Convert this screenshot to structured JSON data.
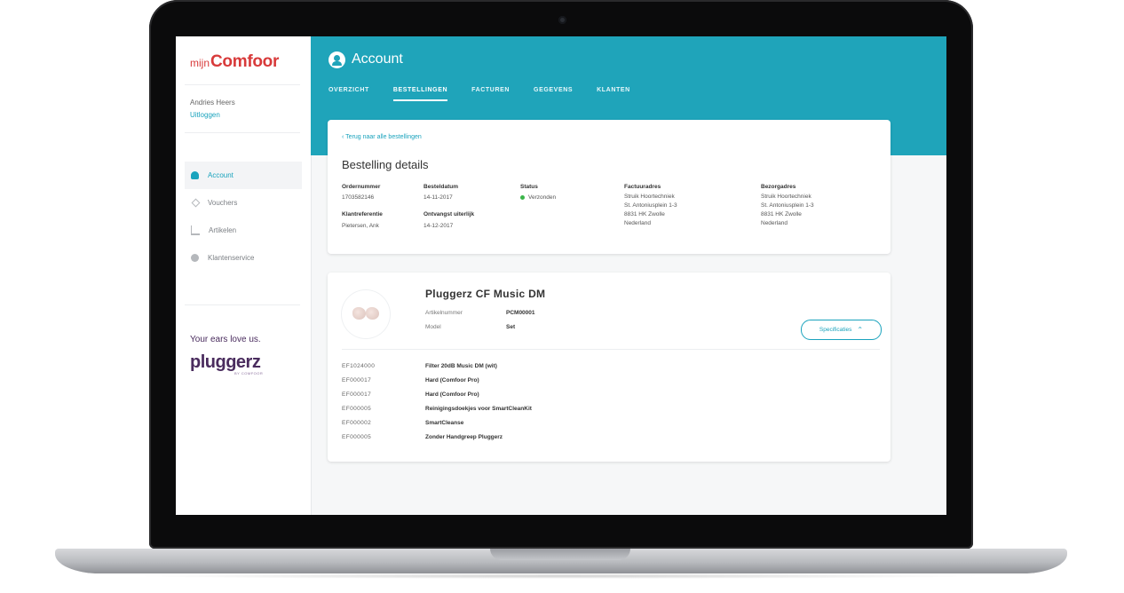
{
  "sidebar": {
    "logo_prefix": "mijn",
    "logo_main": "Comfoor",
    "user_name": "Andries Heers",
    "logout": "Uitloggen",
    "nav": [
      {
        "label": "Account",
        "icon": "user-icon",
        "active": true
      },
      {
        "label": "Vouchers",
        "icon": "tag-icon",
        "active": false
      },
      {
        "label": "Artikelen",
        "icon": "cart-icon",
        "active": false
      },
      {
        "label": "Klantenservice",
        "icon": "help-icon",
        "active": false
      }
    ],
    "tagline": "Your ears love us.",
    "brand": "pluggerz",
    "brand_sub": "BY COMFOOR"
  },
  "header": {
    "title": "Account",
    "tabs": [
      {
        "label": "OVERZICHT",
        "active": false
      },
      {
        "label": "BESTELLINGEN",
        "active": true
      },
      {
        "label": "FACTUREN",
        "active": false
      },
      {
        "label": "GEGEVENS",
        "active": false
      },
      {
        "label": "KLANTEN",
        "active": false
      }
    ]
  },
  "order": {
    "back_link": "Terug naar alle bestellingen",
    "title": "Bestelling details",
    "order_number_label": "Ordernummer",
    "order_number": "1703582146",
    "order_date_label": "Besteldatum",
    "order_date": "14-11-2017",
    "status_label": "Status",
    "status": "Verzonden",
    "status_color": "#3bb54a",
    "customer_ref_label": "Klantreferentie",
    "customer_ref": "Pietersen, Ank",
    "expected_label": "Ontvangst uiterlijk",
    "expected_date": "14-12-2017",
    "billing_label": "Factuuradres",
    "billing_lines": [
      "Struik Hoortechniek",
      "St. Antoniusplein 1-3",
      "8831 HK Zwolle",
      "Nederland"
    ],
    "shipping_label": "Bezorgadres",
    "shipping_lines": [
      "Struik Hoortechniek",
      "St. Antoniusplein 1-3",
      "8831 HK Zwolle",
      "Nederland"
    ]
  },
  "product": {
    "title": "Pluggerz CF Music DM",
    "article_label": "Artikelnummer",
    "article_value": "PCM00001",
    "model_label": "Model",
    "model_value": "Set",
    "spec_button": "Specificaties",
    "items": [
      {
        "code": "EF1024000",
        "desc": "Filter 20dB Music DM (wit)"
      },
      {
        "code": "EF000017",
        "desc": "Hard (Comfoor Pro)"
      },
      {
        "code": "EF000017",
        "desc": "Hard (Comfoor Pro)"
      },
      {
        "code": "EF000005",
        "desc": "Reinigingsdoekjes voor SmartCleanKit"
      },
      {
        "code": "EF000002",
        "desc": "SmartCleanse"
      },
      {
        "code": "EF000005",
        "desc": "Zonder Handgreep Pluggerz"
      }
    ]
  },
  "colors": {
    "accent": "#1fa4ba",
    "logo": "#d83a3a",
    "brand": "#4a2c5e"
  }
}
